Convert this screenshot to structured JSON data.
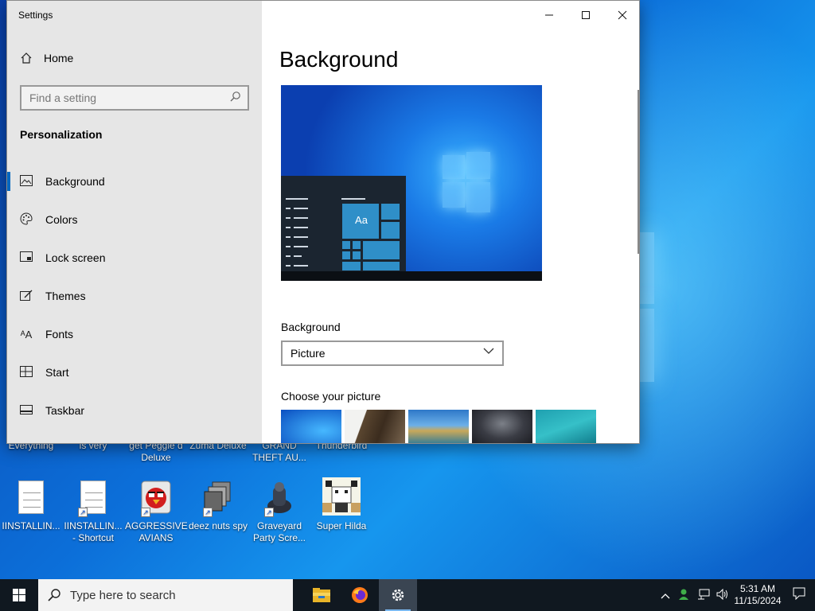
{
  "window": {
    "title": "Settings",
    "controls": {
      "minimize": "—",
      "maximize": "☐",
      "close": "✕"
    }
  },
  "sidebar": {
    "home_label": "Home",
    "search_placeholder": "Find a setting",
    "section_title": "Personalization",
    "items": [
      {
        "label": "Background",
        "icon": "image-icon",
        "active": true
      },
      {
        "label": "Colors",
        "icon": "palette-icon"
      },
      {
        "label": "Lock screen",
        "icon": "lock-screen-icon"
      },
      {
        "label": "Themes",
        "icon": "themes-icon"
      },
      {
        "label": "Fonts",
        "icon": "fonts-icon"
      },
      {
        "label": "Start",
        "icon": "start-icon"
      },
      {
        "label": "Taskbar",
        "icon": "taskbar-icon"
      }
    ]
  },
  "main": {
    "page_title": "Background",
    "preview_tile_text": "Aa",
    "background_label": "Background",
    "background_value": "Picture",
    "choose_label": "Choose your picture",
    "thumbnails": [
      "windows-blue",
      "cliff-tree",
      "beach-rocks",
      "night-sky",
      "underwater"
    ]
  },
  "desktop": {
    "partial_labels": [
      "Everything",
      "is very",
      "get Peggle d\nDeluxe",
      "Zuma Deluxe",
      "GRAND\nTHEFT AU...",
      "Thunderbird"
    ],
    "icons": [
      {
        "label": "IINSTALLIN...",
        "icon": "document-icon",
        "shortcut": false
      },
      {
        "label": "IINSTALLIN...\n- Shortcut",
        "icon": "document-icon",
        "shortcut": true
      },
      {
        "label": "AGGRESSIVE\nAVIANS",
        "icon": "angry-bird-icon",
        "shortcut": true
      },
      {
        "label": "deez nuts spy",
        "icon": "stacked-windows-icon",
        "shortcut": true
      },
      {
        "label": "Graveyard\nParty Scre...",
        "icon": "graveyard-icon",
        "shortcut": true
      },
      {
        "label": "Super Hilda",
        "icon": "pixel-character-icon",
        "shortcut": false
      }
    ]
  },
  "taskbar": {
    "search_placeholder": "Type here to search",
    "apps": [
      "file-explorer-icon",
      "firefox-icon",
      "settings-gear-icon"
    ],
    "time": "5:31 AM",
    "date": "11/15/2024"
  },
  "colors": {
    "accent": "#0067c0",
    "sidebar_bg": "#e6e6e6",
    "taskbar_bg": "#101820"
  }
}
